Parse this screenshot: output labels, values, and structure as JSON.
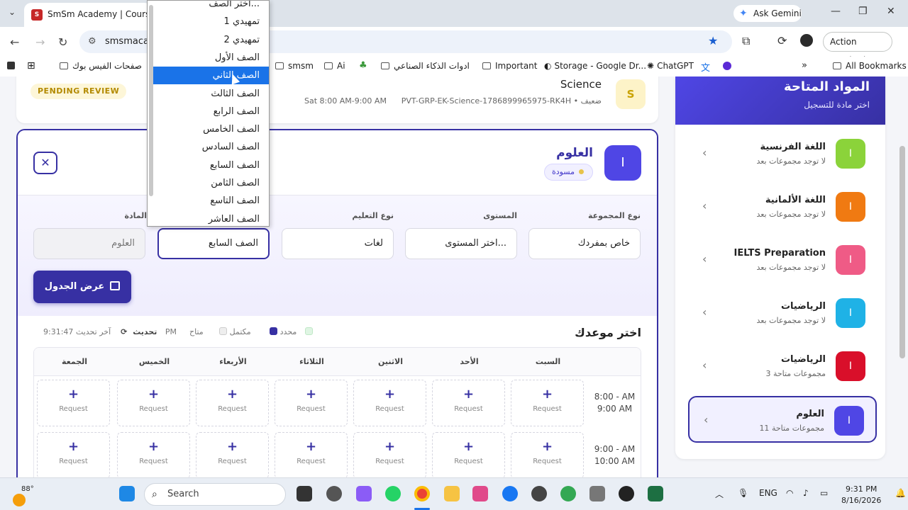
{
  "browser": {
    "tab_title": "SmSm Academy | Course Re",
    "tab_favicon": "S",
    "ask_gemini": "Ask Gemini",
    "url": "smsmacad",
    "action_required": "Action required",
    "bookmarks": [
      "صفحات الفيس بوك",
      "smsm",
      "Ai",
      "ادوات الذكاء الصناعي",
      "Important",
      "Storage - Google Dr...",
      "ChatGPT"
    ],
    "all_bookmarks": "All Bookmarks"
  },
  "top_card": {
    "status": "PENDING REVIEW",
    "subject": "Science",
    "meta": "PVT-GRP-EK-Science-1786899965975-RK4H • ضعيف",
    "time": "Sat 8:00 AM-9:00 AM",
    "avatar": "S"
  },
  "main_card": {
    "icon_letter": "I",
    "title": "العلوم",
    "badge": "مسودة",
    "close": "✕",
    "fields": [
      {
        "label": "نوع المجموعة",
        "value": "خاص بمفردك"
      },
      {
        "label": "المستوى",
        "value": "اختر المستوى..."
      },
      {
        "label": "نوع التعليم",
        "value": "لغات"
      },
      {
        "label": "",
        "value": "الصف السابع"
      },
      {
        "label": "المادة",
        "value": "العلوم"
      }
    ],
    "show_button": "عرض الجدول",
    "pick_title": "اختر موعدك",
    "legend": {
      "available": "متاح",
      "full": "مكتمل",
      "selected": "محدد",
      "updated": "آخر تحديث 9:31:47 PM",
      "refresh": "تحديث"
    },
    "days": [
      "السبت",
      "الأحد",
      "الاثنين",
      "الثلاثاء",
      "الأربعاء",
      "الخميس",
      "الجمعة"
    ],
    "times": [
      [
        "8:00 - AM",
        "9:00 AM"
      ],
      [
        "9:00 - AM",
        "10:00 AM"
      ]
    ],
    "cell_plus": "+",
    "cell_label": "Request"
  },
  "dropdown": {
    "options": [
      "اختر الصف...",
      "تمهيدي 1",
      "تمهيدي 2",
      "الصف الأول",
      "الصف الثاني",
      "الصف الثالث",
      "الصف الرابع",
      "الصف الخامس",
      "الصف السادس",
      "الصف السابع",
      "الصف الثامن",
      "الصف التاسع",
      "الصف العاشر"
    ],
    "highlighted_index": 4
  },
  "subjects_panel": {
    "title": "المواد المتاحة",
    "subtitle": "اختر مادة للتسجيل",
    "items": [
      {
        "letter": "I",
        "name": "اللغة الفرنسية",
        "status": "لا توجد مجموعات بعد",
        "color": "#8bd33a"
      },
      {
        "letter": "I",
        "name": "اللغة الألمانية",
        "status": "لا توجد مجموعات بعد",
        "color": "#f07a12"
      },
      {
        "letter": "I",
        "name": "IELTS Preparation",
        "status": "لا توجد مجموعات بعد",
        "color": "#ef5b86"
      },
      {
        "letter": "I",
        "name": "الرياضيات",
        "status": "لا توجد مجموعات بعد",
        "color": "#1fb2e6"
      },
      {
        "letter": "I",
        "name": "الرياضيات",
        "status": "3 مجموعات متاحة",
        "color": "#d90f2a"
      },
      {
        "letter": "I",
        "name": "العلوم",
        "status": "11 مجموعات متاحة",
        "color": "#4f46e5"
      }
    ]
  },
  "taskbar": {
    "weather": "88°",
    "search": "Search",
    "lang": "ENG",
    "time": "9:31 PM",
    "date": "8/16/2026"
  }
}
